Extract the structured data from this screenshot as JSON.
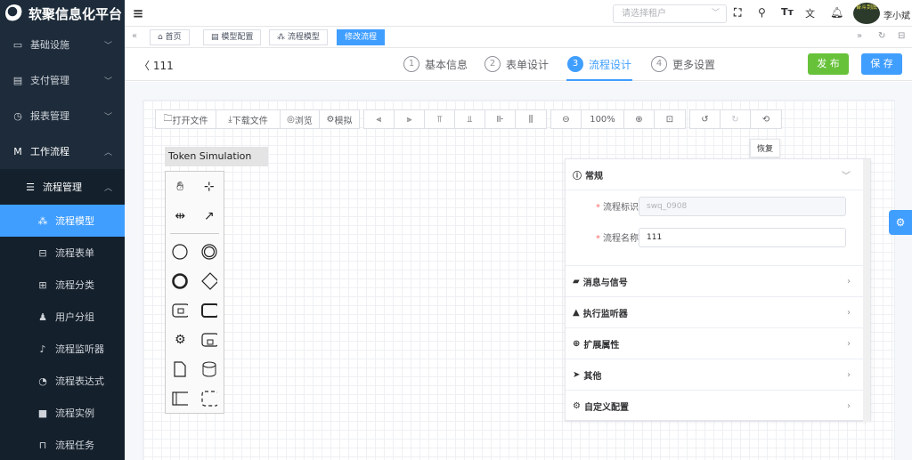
{
  "app": {
    "title": "软聚信息化平台"
  },
  "sidebar": {
    "items": [
      {
        "label": "基础设施",
        "icon": "monitor-icon"
      },
      {
        "label": "支付管理",
        "icon": "payment-icon"
      },
      {
        "label": "报表管理",
        "icon": "chart-icon"
      },
      {
        "label": "工作流程",
        "icon": "workflow-icon"
      }
    ],
    "group": {
      "label": "流程管理"
    },
    "sub_items": [
      {
        "label": "流程模型"
      },
      {
        "label": "流程表单"
      },
      {
        "label": "流程分类"
      },
      {
        "label": "用户分组"
      },
      {
        "label": "流程监听器"
      },
      {
        "label": "流程表达式"
      },
      {
        "label": "流程实例"
      },
      {
        "label": "流程任务"
      }
    ]
  },
  "topbar": {
    "tenant_placeholder": "请选择租户",
    "user_name": "李小斌",
    "avatar_text": "奋斗到底"
  },
  "tags": [
    "首页",
    "模型配置",
    "流程模型",
    "修改流程"
  ],
  "header": {
    "back_label": "111",
    "steps": [
      {
        "num": "1",
        "label": "基本信息"
      },
      {
        "num": "2",
        "label": "表单设计"
      },
      {
        "num": "3",
        "label": "流程设计"
      },
      {
        "num": "4",
        "label": "更多设置"
      }
    ],
    "publish_label": "发 布",
    "save_label": "保 存"
  },
  "toolbar": {
    "open_file": "打开文件",
    "download_file": "下载文件",
    "preview": "浏览",
    "simulate": "模拟",
    "zoom": "100%",
    "tooltip": "恢复"
  },
  "token_simulation": {
    "label": "Token Simulation"
  },
  "properties": {
    "general_label": "常规",
    "process_id_label": "流程标识",
    "process_id_value": "swq_0908",
    "process_name_label": "流程名称",
    "process_name_value": "111",
    "sections": [
      "消息与信号",
      "执行监听器",
      "扩展属性",
      "其他",
      "自定义配置"
    ]
  },
  "colors": {
    "primary": "#409eff",
    "success": "#67c23a",
    "sidebar": "#1d2b3a"
  }
}
